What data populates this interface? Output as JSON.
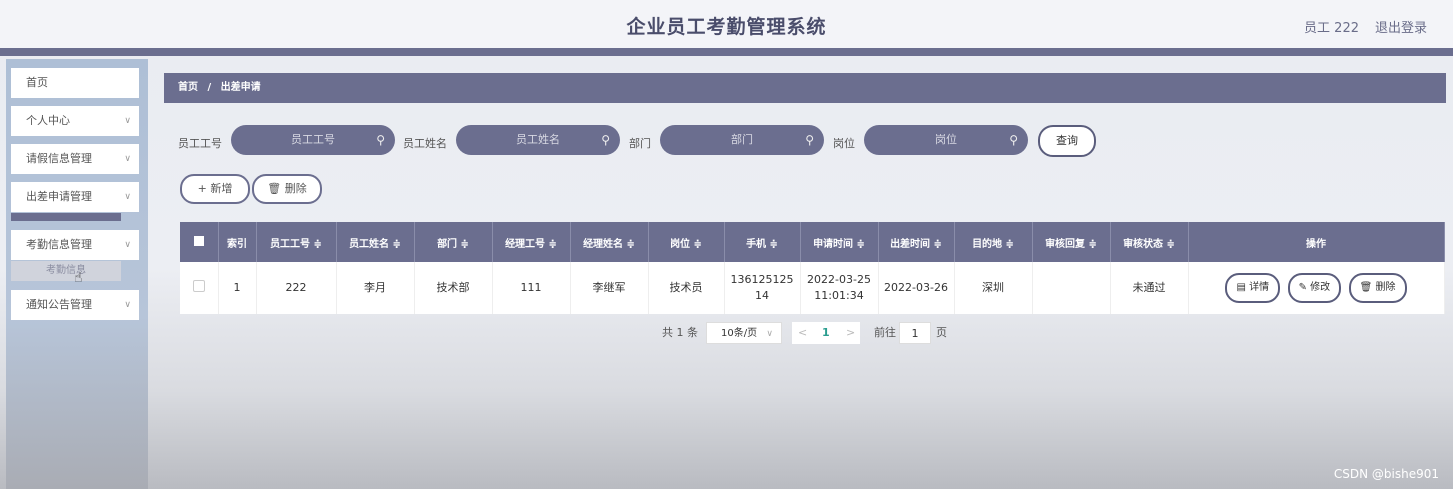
{
  "header": {
    "title": "企业员工考勤管理系统",
    "user": "员工 222",
    "logout": "退出登录"
  },
  "sidebar": {
    "items": [
      {
        "label": "首页",
        "chevron": false
      },
      {
        "label": "个人中心",
        "chevron": true
      },
      {
        "label": "请假信息管理",
        "chevron": true
      },
      {
        "label": "出差申请管理",
        "chevron": true
      },
      {
        "label": "考勤信息管理",
        "chevron": true
      },
      {
        "label": "通知公告管理",
        "chevron": true
      }
    ],
    "sub_item": "考勤信息"
  },
  "breadcrumb": {
    "home": "首页",
    "sep": "/",
    "current": "出差申请"
  },
  "search": {
    "fields": [
      {
        "label": "员工工号",
        "placeholder": "员工工号"
      },
      {
        "label": "员工姓名",
        "placeholder": "员工姓名"
      },
      {
        "label": "部门",
        "placeholder": "部门"
      },
      {
        "label": "岗位",
        "placeholder": "岗位"
      }
    ],
    "query_label": "查询"
  },
  "ops": {
    "add_label": "+ 新增",
    "delete_label": "删除"
  },
  "table": {
    "columns": [
      "索引",
      "员工工号 ≑",
      "员工姓名 ≑",
      "部门 ≑",
      "经理工号 ≑",
      "经理姓名 ≑",
      "岗位 ≑",
      "手机 ≑",
      "申请时间 ≑",
      "出差时间 ≑",
      "目的地 ≑",
      "审核回复 ≑",
      "审核状态 ≑",
      "操作"
    ],
    "rows": [
      {
        "index": "1",
        "emp_id": "222",
        "emp_name": "李月",
        "dept": "技术部",
        "mgr_id": "111",
        "mgr_name": "李继军",
        "post": "技术员",
        "phone_1": "136125125",
        "phone_2": "14",
        "apply_date": "2022-03-25",
        "apply_time": "11:01:34",
        "trip_date": "2022-03-26",
        "dest": "深圳",
        "reply": "",
        "status": "未通过"
      }
    ],
    "actions": {
      "detail": "详情",
      "edit": "修改",
      "delete": "删除"
    }
  },
  "pagination": {
    "total": "共 1 条",
    "page_size": "10条/页",
    "prev": "<",
    "current": "1",
    "next": ">",
    "goto": "前往",
    "goto_value": "1",
    "page_unit": "页"
  },
  "watermark": "CSDN @bishe901"
}
